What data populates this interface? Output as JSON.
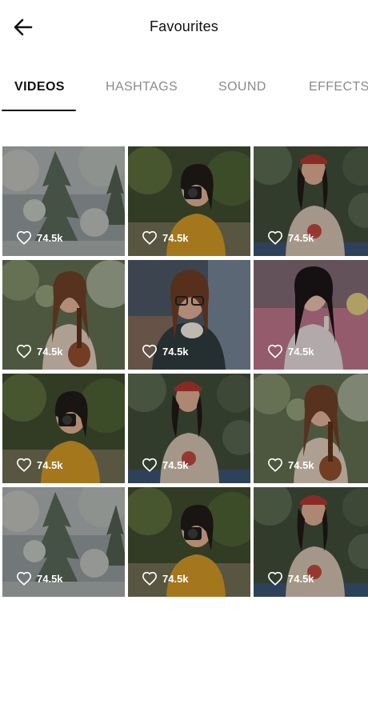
{
  "header": {
    "title": "Favourites"
  },
  "tabs": [
    {
      "label": "VIDEOS",
      "active": true
    },
    {
      "label": "HASHTAGS",
      "active": false
    },
    {
      "label": "SOUND",
      "active": false
    },
    {
      "label": "EFFECTS",
      "active": false
    }
  ],
  "grid": {
    "items": [
      {
        "subject": "snowy-pine",
        "likes": "74.5k"
      },
      {
        "subject": "camera-girl-yellow",
        "likes": "74.5k"
      },
      {
        "subject": "girl-red-cap",
        "likes": "74.5k"
      },
      {
        "subject": "ukulele-girl",
        "likes": "74.5k"
      },
      {
        "subject": "glasses-girl-cup",
        "likes": "74.5k"
      },
      {
        "subject": "girl-pink-sofa",
        "likes": "74.5k"
      },
      {
        "subject": "camera-girl-yellow",
        "likes": "74.5k"
      },
      {
        "subject": "girl-red-cap",
        "likes": "74.5k"
      },
      {
        "subject": "ukulele-girl",
        "likes": "74.5k"
      },
      {
        "subject": "snowy-pine",
        "likes": "74.5k"
      },
      {
        "subject": "camera-girl-yellow",
        "likes": "74.5k"
      },
      {
        "subject": "girl-red-cap",
        "likes": "74.5k"
      }
    ]
  },
  "icons": {
    "back": "arrow-left-icon",
    "like": "heart-outline-icon"
  },
  "colors": {
    "active_tab": "#111111",
    "inactive_tab": "#8a8a8a",
    "overlay_text": "#ffffff"
  }
}
